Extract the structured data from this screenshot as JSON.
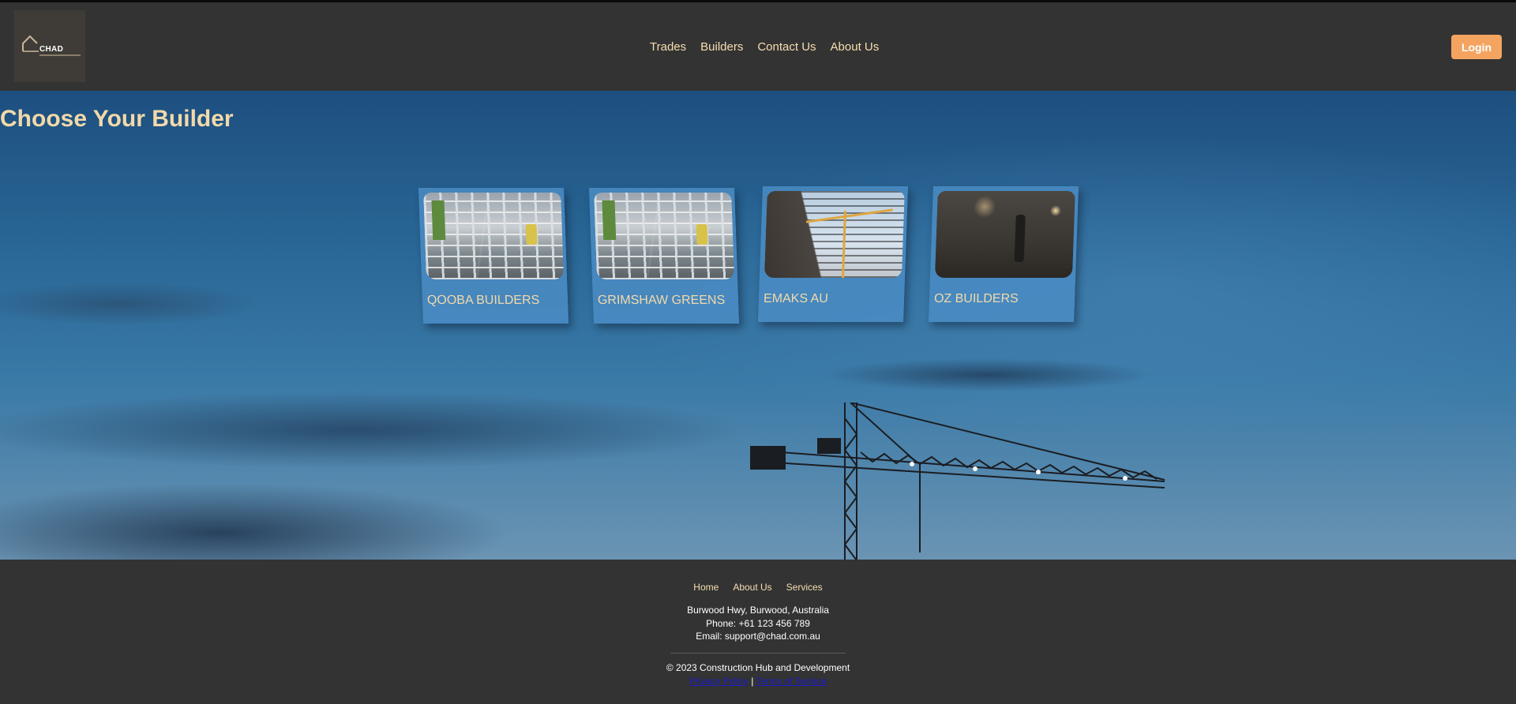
{
  "header": {
    "logo_text": "CHAD",
    "nav": [
      "Trades",
      "Builders",
      "Contact Us",
      "About Us"
    ],
    "login_label": "Login"
  },
  "hero": {
    "title": "Choose Your Builder"
  },
  "builders": [
    {
      "name": "QOOBA BUILDERS",
      "image": "scaffold-photo"
    },
    {
      "name": "GRIMSHAW GREENS",
      "image": "scaffold-photo"
    },
    {
      "name": "EMAKS AU",
      "image": "building-crane-photo"
    },
    {
      "name": "OZ BUILDERS",
      "image": "interior-worker-photo"
    }
  ],
  "footer": {
    "nav": [
      "Home",
      "About Us",
      "Services"
    ],
    "address": "Burwood Hwy, Burwood, Australia",
    "phone": "Phone: +61 123 456 789",
    "email": "Email: support@chad.com.au",
    "copyright": "© 2023 Construction Hub and Development",
    "privacy": "Privacy Policy",
    "separator": "|",
    "terms": "Terms of Service"
  },
  "colors": {
    "accent": "#f4a460",
    "nav_text": "#f7deb0",
    "header_bg": "#333333"
  }
}
